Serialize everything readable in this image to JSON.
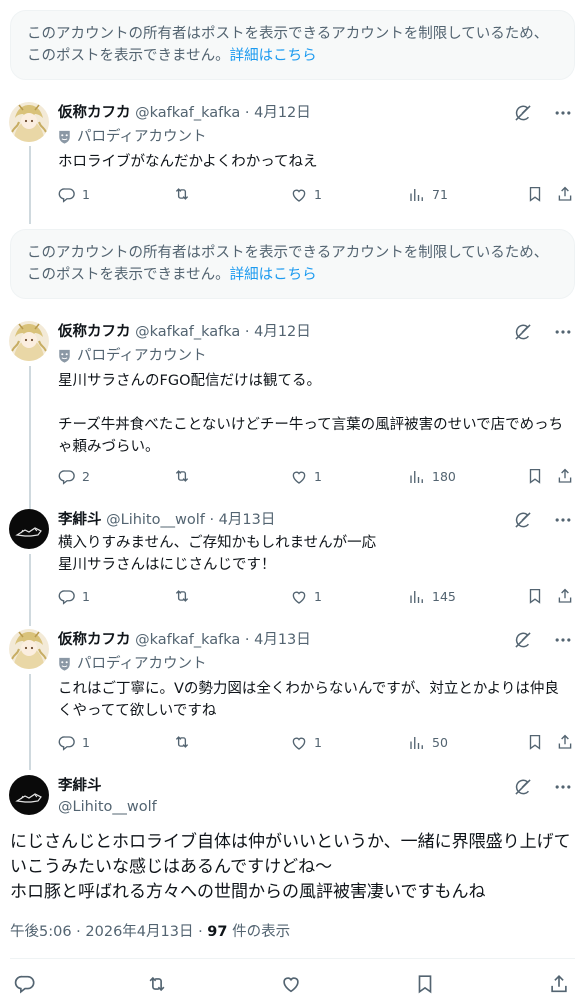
{
  "notices": [
    {
      "text": "このアカウントの所有者はポストを表示できるアカウントを制限しているため、このポストを表示できません。",
      "link": "詳細はこちら"
    },
    {
      "text": "このアカウントの所有者はポストを表示できるアカウントを制限しているため、このポストを表示できません。",
      "link": "詳細はこちら"
    }
  ],
  "tweets": [
    {
      "name": "仮称カフカ",
      "meta": "@kafkaf_kafka · 4月12日",
      "parody": "パロディアカウント",
      "text": "ホロライブがなんだかよくわかってねえ",
      "replies": "1",
      "retweets": "",
      "likes": "1",
      "views": "71"
    },
    {
      "name": "仮称カフカ",
      "meta": "@kafkaf_kafka · 4月12日",
      "parody": "パロディアカウント",
      "text": "星川サラさんのFGO配信だけは観てる。\n\nチーズ牛丼食べたことないけどチー牛って言葉の風評被害のせいで店でめっちゃ頼みづらい。",
      "replies": "2",
      "retweets": "",
      "likes": "1",
      "views": "180"
    },
    {
      "name": "李緋斗",
      "meta": "@Lihito__wolf · 4月13日",
      "text": "横入りすみません、ご存知かもしれませんが一応\n星川サラさんはにじさんじです！",
      "replies": "1",
      "retweets": "",
      "likes": "1",
      "views": "145"
    },
    {
      "name": "仮称カフカ",
      "meta": "@kafkaf_kafka · 4月13日",
      "parody": "パロディアカウント",
      "text": "これはご丁寧に。Vの勢力図は全くわからないんですが、対立とかよりは仲良くやってて欲しいですね",
      "replies": "1",
      "retweets": "",
      "likes": "1",
      "views": "50"
    }
  ],
  "main": {
    "name": "李緋斗",
    "handle": "@Lihito__wolf",
    "text": "にじさんじとホロライブ自体は仲がいいというか、一緒に界隈盛り上げていこうみたいな感じはあるんですけどね〜\nホロ豚と呼ばれる方々への世間からの風評被害凄いですもんね",
    "time": "午後5:06 · 2026年4月13日 · ",
    "views_count": "97",
    "views_suffix": " 件の表示"
  },
  "icons": {
    "reply": "reply-icon",
    "retweet": "retweet-icon",
    "like": "like-icon",
    "views": "views-icon",
    "bookmark": "bookmark-icon",
    "share": "share-icon",
    "grok": "grok-icon",
    "more": "more-icon",
    "parody": "parody-mask-icon"
  },
  "colors": {
    "link": "#1d9bf0",
    "secondary": "#536471",
    "text": "#0f1419",
    "notice_bg": "#f7f9f9"
  }
}
